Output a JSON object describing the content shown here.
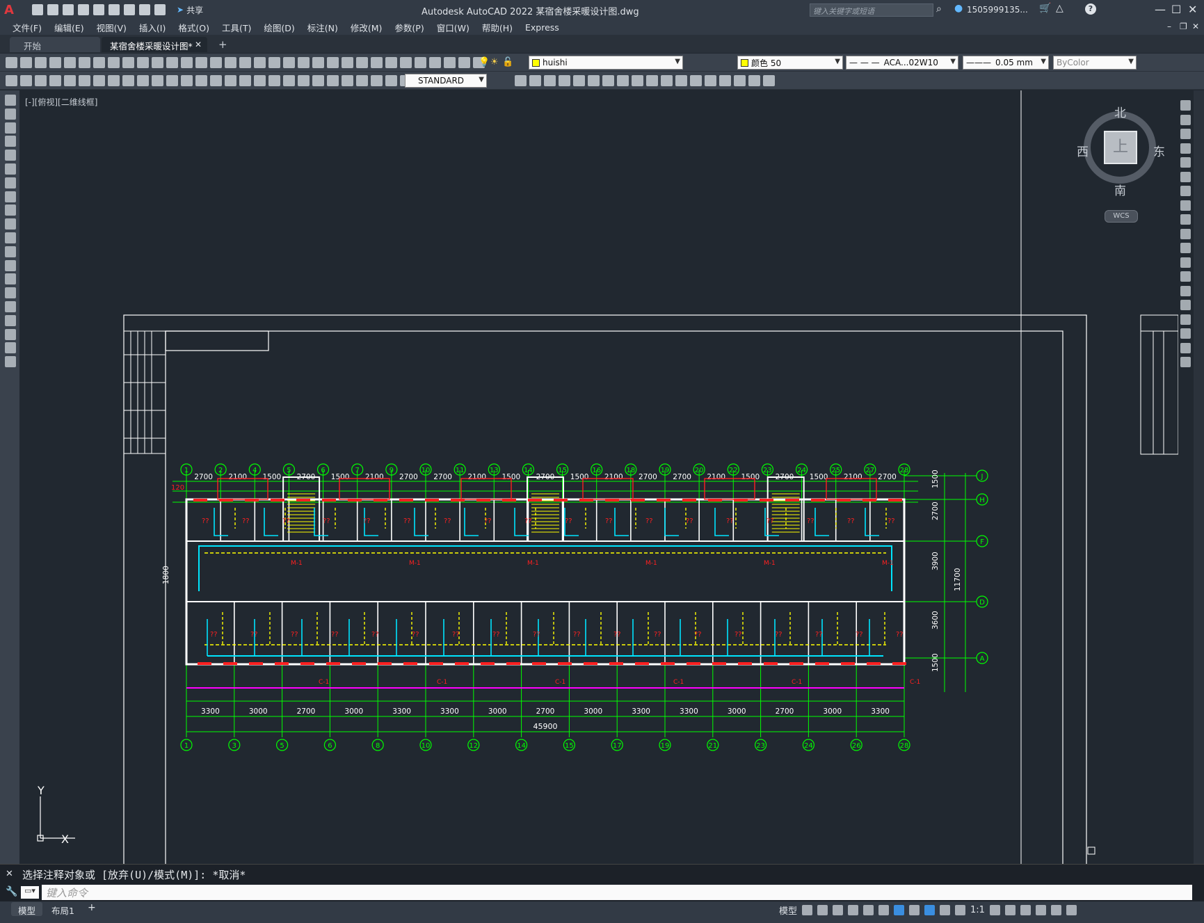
{
  "titlebar": {
    "app_title": "Autodesk AutoCAD 2022    某宿舍楼采暖设计图.dwg",
    "share_label": "共享",
    "search_placeholder": "键入关键字或短语",
    "user_name": "1505999135...",
    "minimize": "—",
    "restore": "☐",
    "close": "✕"
  },
  "menu": {
    "items": [
      "文件(F)",
      "编辑(E)",
      "视图(V)",
      "插入(I)",
      "格式(O)",
      "工具(T)",
      "绘图(D)",
      "标注(N)",
      "修改(M)",
      "参数(P)",
      "窗口(W)",
      "帮助(H)",
      "Express"
    ]
  },
  "tabs": {
    "start": "开始",
    "document": "某宿舍楼采暖设计图*",
    "close": "✕",
    "add": "+"
  },
  "toolbar": {
    "layer_name": "huishi",
    "color_name": "颜色 50",
    "linetype": "ACA...02W10",
    "lineweight": "0.05 mm",
    "plotstyle": "ByColor",
    "textstyle": "STANDARD"
  },
  "viewport": {
    "label": "[-][俯视][二维线框]"
  },
  "viewcube": {
    "north": "北",
    "south": "南",
    "east": "东",
    "west": "西",
    "face": "上",
    "wcs": "WCS"
  },
  "ucs": {
    "x": "X",
    "y": "Y"
  },
  "drawing": {
    "axis_top": [
      "1",
      "2",
      "4",
      "5",
      "6",
      "7",
      "9",
      "10",
      "11",
      "13",
      "14",
      "15",
      "16",
      "18",
      "19",
      "20",
      "22",
      "23",
      "24",
      "25",
      "27",
      "28"
    ],
    "axis_bottom": [
      "1",
      "3",
      "5",
      "6",
      "8",
      "10",
      "12",
      "14",
      "15",
      "17",
      "19",
      "21",
      "23",
      "24",
      "26",
      "28"
    ],
    "axis_right": [
      "J",
      "H",
      "F",
      "D",
      "A"
    ],
    "dims_top": [
      "2700",
      "2100",
      "1500",
      "2700",
      "1500",
      "2100",
      "2700",
      "2700",
      "2100",
      "1500",
      "2700",
      "1500",
      "2100",
      "2700",
      "2700",
      "2100",
      "1500",
      "2700",
      "1500",
      "2100",
      "2700"
    ],
    "dims_bottom": [
      "3300",
      "3000",
      "2700",
      "3000",
      "3300",
      "3300",
      "3000",
      "2700",
      "3000",
      "3300",
      "3300",
      "3000",
      "2700",
      "3000",
      "3300"
    ],
    "total_dim": "45900",
    "dims_right": [
      "1500",
      "2700",
      "3900",
      "3600",
      "1500"
    ],
    "total_right": "11700",
    "left_dim": "1800",
    "edge_dim": "120",
    "room_mark": "??",
    "door_mark": "M-1",
    "window_mark": "C-1"
  },
  "command": {
    "history": "选择注释对象或 [放弃(U)/模式(M)]: *取消*",
    "placeholder": "键入命令"
  },
  "status": {
    "model_tab": "模型",
    "layout1_tab": "布局1",
    "add": "+",
    "model_button": "模型",
    "scale": "1:1"
  },
  "colors": {
    "drawing_bg": "#212830",
    "axis_green": "#00ff00",
    "wall_white": "#ffffff",
    "pipe_cyan": "#00e5ff",
    "pipe_yellow": "#ffff00",
    "text_red": "#ff2020",
    "magenta": "#ff00ff"
  }
}
